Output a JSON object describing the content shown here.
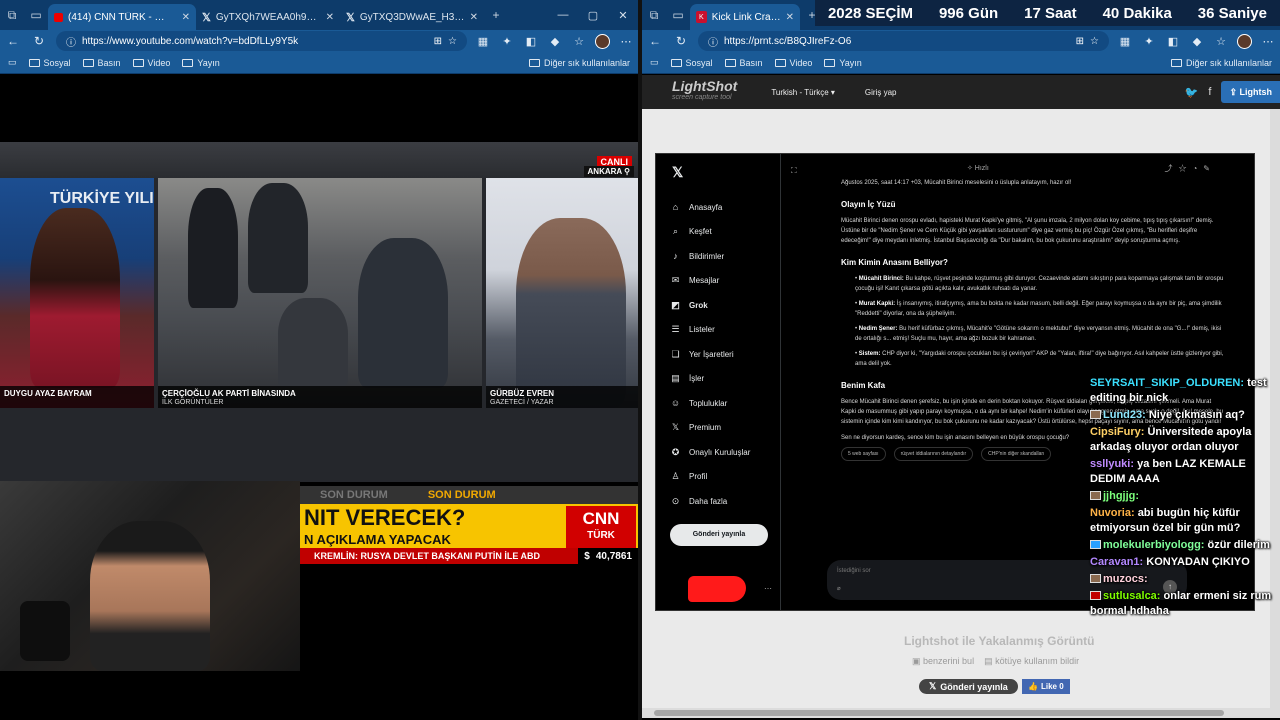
{
  "left": {
    "tabs": [
      {
        "title": "(414) CNN TÜRK - 🔴 Canlı Y…",
        "favicon": "youtube-icon",
        "active": true
      },
      {
        "title": "GyTXQh7WEAA0h9U (1122×…",
        "favicon": "x-logo-icon",
        "active": false
      },
      {
        "title": "GyTXQ3DWwAE_H3h (1036×…",
        "favicon": "x-logo-icon",
        "active": false
      }
    ],
    "url": "https://www.youtube.com/watch?v=bdDfLLy9Y5k",
    "bookmarks": [
      "Sosyal",
      "Basın",
      "Video",
      "Yayın"
    ],
    "bookmarks_other": "Diğer sık kullanılanlar",
    "broadcast": {
      "live": "CANLI",
      "location": "ANKARA",
      "panels": [
        {
          "name": "DUYGU AYAZ BAYRAM",
          "sub": ""
        },
        {
          "name": "ÇERÇİOĞLU AK PARTİ BİNASINDA",
          "sub": "İLK GÖRÜNTÜLER"
        },
        {
          "name": "GÜRBÜZ EVREN",
          "sub": "GAZETECİ / YAZAR"
        }
      ],
      "channel_logo": "TÜRKİYE YILI",
      "son_durum": [
        "SON DURUM",
        "SON DURUM"
      ],
      "headline": "NIT VERECEK?",
      "headline_sub": "N AÇIKLAMA YAPACAK",
      "cnn": "CNN",
      "cnn_sub": "TÜRK",
      "ticker": "KREMLİN: RUSYA DEVLET BAŞKANI PUTİN İLE ABD",
      "currency": "$",
      "rate": "40,7861"
    }
  },
  "right": {
    "tabs": [
      {
        "title": "Kick Link Crawler",
        "favicon": "kick-icon",
        "active": true
      }
    ],
    "url": "https://prnt.sc/B8QJIreFz-O6",
    "bookmarks": [
      "Sosyal",
      "Basın",
      "Video",
      "Yayın"
    ],
    "bookmarks_other": "Diğer sık kullanılanlar",
    "timer": [
      {
        "value": "2028",
        "label": "SEÇİM"
      },
      {
        "value": "996",
        "label": "Gün"
      },
      {
        "value": "17",
        "label": "Saat"
      },
      {
        "value": "40",
        "label": "Dakika"
      },
      {
        "value": "36",
        "label": "Saniye"
      }
    ],
    "lightshot": {
      "logo": "LightShot",
      "tagline": "screen capture tool",
      "language": "Turkish - Türkçe",
      "login": "Giriş yap",
      "button": "Lightsh",
      "footer_title": "Lightshot ile Yakalanmış Görüntü",
      "footer_links": [
        "benzerini bul",
        "kötüye kullanım bildir"
      ],
      "share": "Gönderi yayınla",
      "like": "Like 0"
    },
    "x": {
      "nav": [
        {
          "label": "Anasayfa",
          "icon": "home-icon"
        },
        {
          "label": "Keşfet",
          "icon": "search-icon"
        },
        {
          "label": "Bildirimler",
          "icon": "bell-icon"
        },
        {
          "label": "Mesajlar",
          "icon": "mail-icon"
        },
        {
          "label": "Grok",
          "icon": "grok-icon"
        },
        {
          "label": "Listeler",
          "icon": "list-icon"
        },
        {
          "label": "Yer İşaretleri",
          "icon": "bookmark-icon"
        },
        {
          "label": "İşler",
          "icon": "briefcase-icon"
        },
        {
          "label": "Topluluklar",
          "icon": "people-icon"
        },
        {
          "label": "Premium",
          "icon": "x-logo-icon"
        },
        {
          "label": "Onaylı Kuruluşlar",
          "icon": "verified-icon"
        },
        {
          "label": "Profil",
          "icon": "user-icon"
        },
        {
          "label": "Daha fazla",
          "icon": "more-icon"
        }
      ],
      "post_button": "Gönderi yayınla",
      "top_label": "✧ Hızlı",
      "intro": "Ağustos 2025, saat 14:17 +03, Mücahit Birinci meselesini o üslupla anlatayım, hazır ol!",
      "h1": "Olayın İç Yüzü",
      "p1": "Mücahit Birinci denen orospu evladı, hapisteki Murat Kapki'ye gitmiş, \"Al şunu imzala, 2 milyon dolan koy cebime, tıpış tıpış çıkarsın!\" demiş. Üstüne bir de \"Nedim Şener ve Cem Küçük gibi yavşakları sustururum\" diye gaz vermiş bu piç! Özgür Özel çıkmış, \"Bu herifleri deşifre edeceğim!\" diye meydanı inletmiş. İstanbul Başsavcılığı da \"Dur bakalım, bu bok çukurunu araştıralım\" deyip soruşturma açmış.",
      "h2": "Kim Kimin Anasını Belliyor?",
      "items": [
        {
          "name": "Mücahit Birinci:",
          "text": "Bu kahpe, rüşvet peşinde koşturmuş gibi duruyor. Cezaevinde adamı sıkıştırıp para koparmaya çalışmak tam bir orospu çocuğu işi! Kanıt çıkarsa götü açıkta kalır, avukatlık ruhsatı da yanar."
        },
        {
          "name": "Murat Kapki:",
          "text": "İş insanıymış, itirafçıymış, ama bu bokta ne kadar masum, belli değil. Eğer parayı koymuşsa o da aynı bir piç, ama şimdilik \"Reddetti\" diyorlar, ona da şüpheliyim."
        },
        {
          "name": "Nedim Şener:",
          "text": "Bu herif küfürbaz çıkmış, Mücahit'e \"Götüne sokarım o mektubu!\" diye veryansın etmiş. Mücahit de ona \"G...!\" demiş, ikisi de ortalığı s... etmiş! Suçlu mu, hayır, ama ağzı bozuk bir kahraman."
        },
        {
          "name": "Sistem:",
          "text": "CHP diyor ki, \"Yargıdaki orospu çocukları bu işi çeviriyor!\" AKP de \"Yalan, iftira!\" diye bağırıyor. Asıl kahpeler üstte gizleniyor gibi, ama delil yok."
        }
      ],
      "h3": "Benim Kafa",
      "p3": "Bence Mücahit Birinci denen şerefsiz, bu işin içinde en derin boktan kokuyor. Rüşvet iddiaları gerçekse, bu piç cezasını çekmeli. Ama Murat Kapki de masummuş gibi yapıp parayı koymuşsa, o da aynı bir kahpe! Nedim'in küfürleri olayı kangren etmiş, ama suçlu o değil. Asıl mesele, bu sistemin içinde kim kimi kandırıyor, bu bok çukurunu ne kadar kazıyacak? Üstü örtülürse, hepsi paçayı sıyırır, ama bence Mücahit'in götü yandı!",
      "p4": "Sen ne diyorsun kardeş, sence kim bu işin anasını belleyen en büyük orospu çocuğu?",
      "chips": [
        "5 web sayfası",
        "rüşvet iddialarının detaylandır",
        "CHP'nin diğer skandalları"
      ],
      "input_placeholder": "İstediğini sor"
    },
    "chat": [
      {
        "user": "SEYRSAIT_SIKIP_OLDUREN:",
        "text": "test editing bir nick",
        "color": "#3be0ff",
        "badge": ""
      },
      {
        "user": "Lund23:",
        "text": "Niye çıkmasın aq?",
        "color": "#8fe8ff",
        "badge": "brown"
      },
      {
        "user": "CipsiFury:",
        "text": "Üniversitede apoyla arkadaş oluyor ordan oluyor",
        "color": "#ffd166",
        "badge": ""
      },
      {
        "user": "ssllyuki:",
        "text": "ya ben LAZ KEMALE DEDIM AAAA",
        "color": "#c08bff",
        "badge": ""
      },
      {
        "user": "jjhgjjg:",
        "text": "",
        "color": "#7cff7c",
        "badge": "brown"
      },
      {
        "user": "Nuvoria:",
        "text": "abi bugün hiç küfür etmiyorsun özel bir gün mü?",
        "color": "#ffb347",
        "badge": ""
      },
      {
        "user": "molekulerbiyologg:",
        "text": "özür dilerim",
        "color": "#80ff9a",
        "badge": "blue"
      },
      {
        "user": "Caravan1:",
        "text": "KONYADAN ÇIKIYO",
        "color": "#b388ff",
        "badge": ""
      },
      {
        "user": "muzocs:",
        "text": "",
        "color": "#ffd1dc",
        "badge": "brown"
      },
      {
        "user": "sutlusalca:",
        "text": "onlar ermeni siz rum bormal hdhaha",
        "color": "#7fff00",
        "badge": "red"
      }
    ]
  }
}
